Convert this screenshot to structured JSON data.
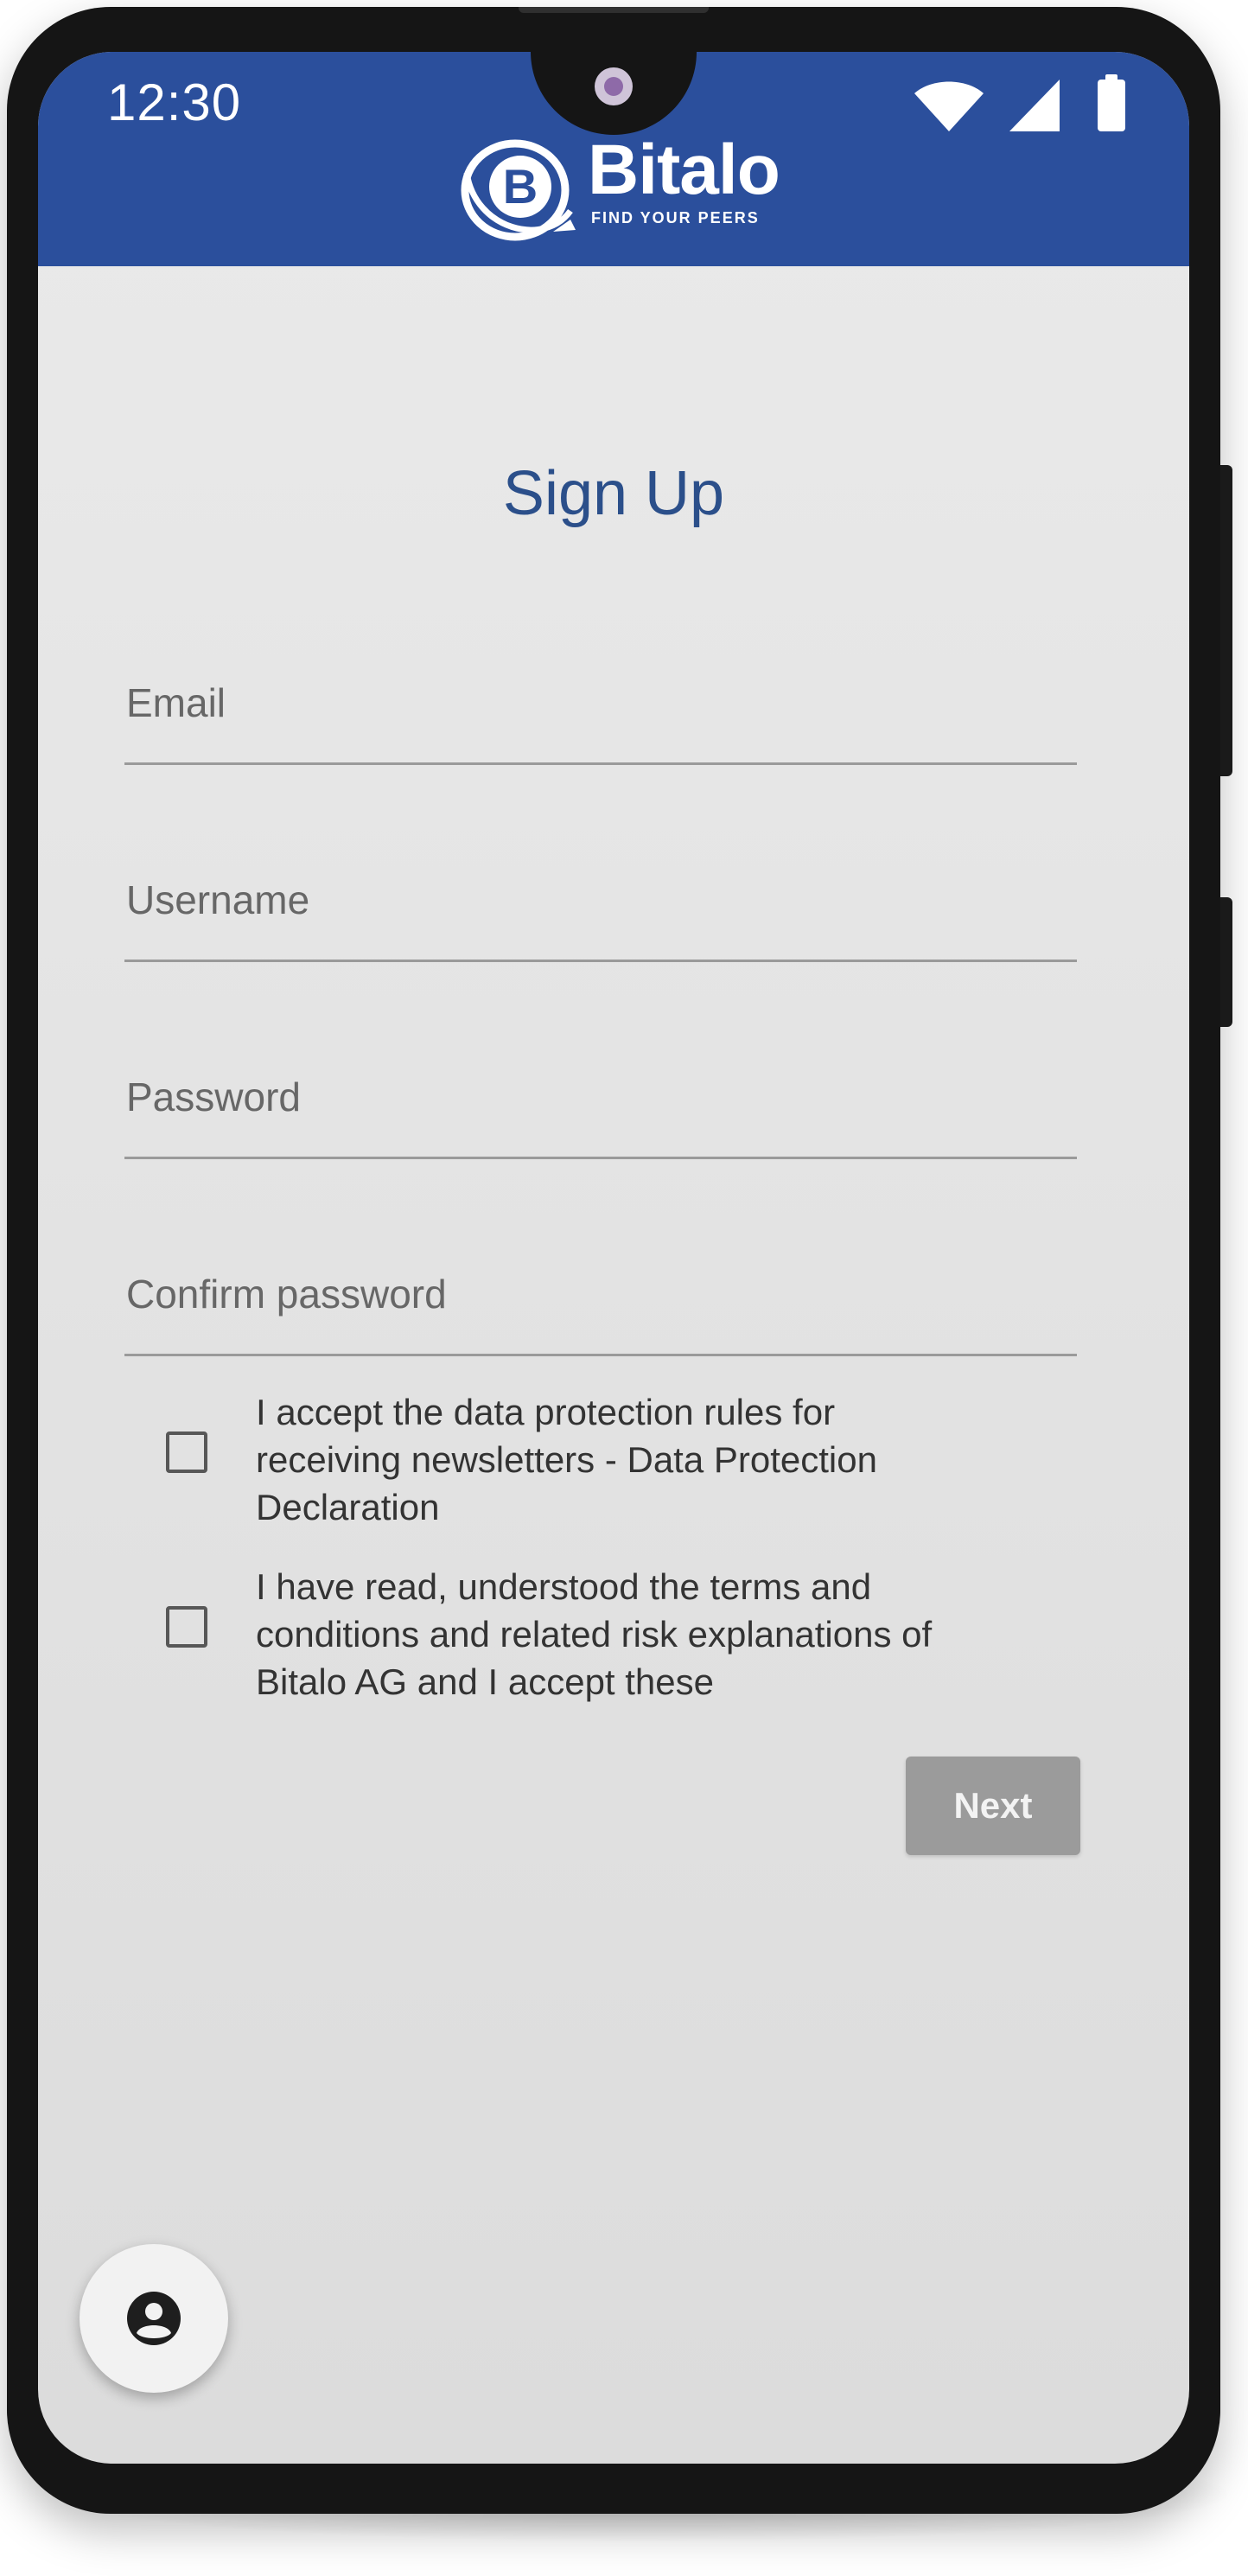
{
  "status_bar": {
    "time": "12:30",
    "icons": [
      "wifi-icon",
      "signal-icon",
      "battery-icon"
    ]
  },
  "header": {
    "logo_text": "Bitalo",
    "logo_tagline": "FIND YOUR PEERS",
    "background_color": "#2b4f9c"
  },
  "form": {
    "title": "Sign Up",
    "fields": [
      {
        "label": "Email"
      },
      {
        "label": "Username"
      },
      {
        "label": "Password"
      },
      {
        "label": "Confirm password"
      }
    ],
    "checkboxes": [
      {
        "lines": [
          "I accept the data protection rules for",
          "receiving newsletters - Data Protection",
          "Declaration"
        ],
        "checked": false
      },
      {
        "lines": [
          "I have read, understood the terms and",
          "conditions and related risk explanations of",
          "Bitalo AG and I accept these"
        ],
        "checked": false
      }
    ],
    "next_label": "Next"
  },
  "fab": {
    "icon": "account-circle-icon"
  }
}
